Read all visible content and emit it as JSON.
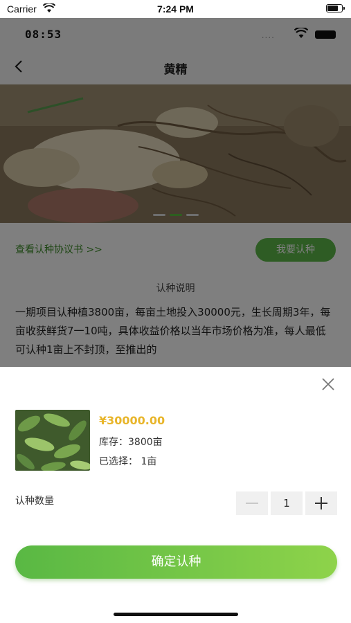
{
  "simulator_status": {
    "carrier": "Carrier",
    "time": "7:24 PM"
  },
  "app_status": {
    "time": "08:53",
    "signal": "...."
  },
  "navbar": {
    "title": "黄精"
  },
  "hero": {
    "image": "huangjing-roots-photo",
    "slide_count": 3,
    "active_slide": 2
  },
  "actions": {
    "agreement_link": "查看认种协议书 >>",
    "cta_label": "我要认种"
  },
  "description": {
    "heading": "认种说明",
    "text": "一期项目认种植3800亩，每亩土地投入30000元，生长周期3年，每亩收获鲜货7一10吨，具体收益价格以当年市场价格为准，每人最低可认种1亩上不封顶，至推出的"
  },
  "sheet": {
    "price": "¥30000.00",
    "stock": "库存：3800亩",
    "selected": "已选择：  1亩",
    "quantity_label": "认种数量",
    "quantity": "1",
    "confirm_label": "确定认种",
    "thumbnail": "huangjing-leaves-photo"
  },
  "colors": {
    "accent": "#5cb848",
    "price": "#e8b52a"
  }
}
